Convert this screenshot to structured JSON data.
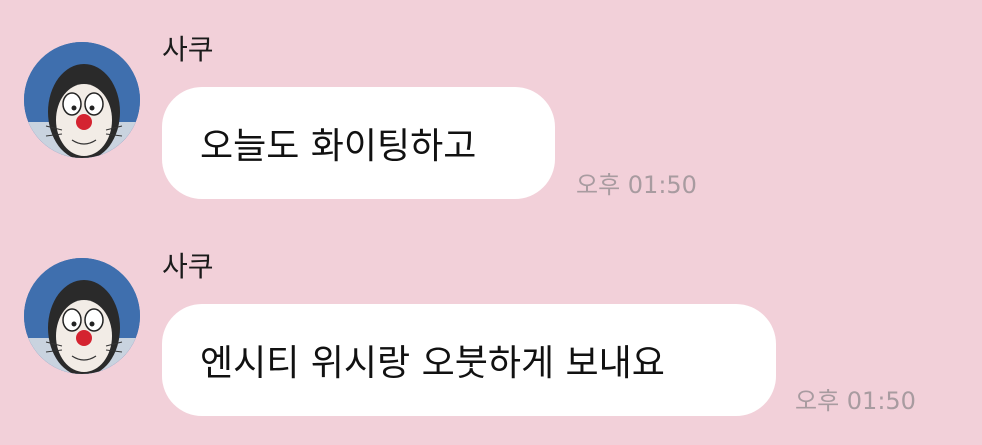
{
  "colors": {
    "background": "#f2d0d9",
    "bubble": "#ffffff",
    "timestamp": "#a89ba0",
    "avatar_background": "#3f6fae"
  },
  "messages": [
    {
      "sender": "사쿠",
      "text": "오늘도 화이팅하고",
      "time": "오후 01:50",
      "avatar_icon": "profile-photo-doraemon-filter"
    },
    {
      "sender": "사쿠",
      "text": "엔시티 위시랑 오붓하게 보내요",
      "time": "오후 01:50",
      "avatar_icon": "profile-photo-doraemon-filter"
    }
  ]
}
